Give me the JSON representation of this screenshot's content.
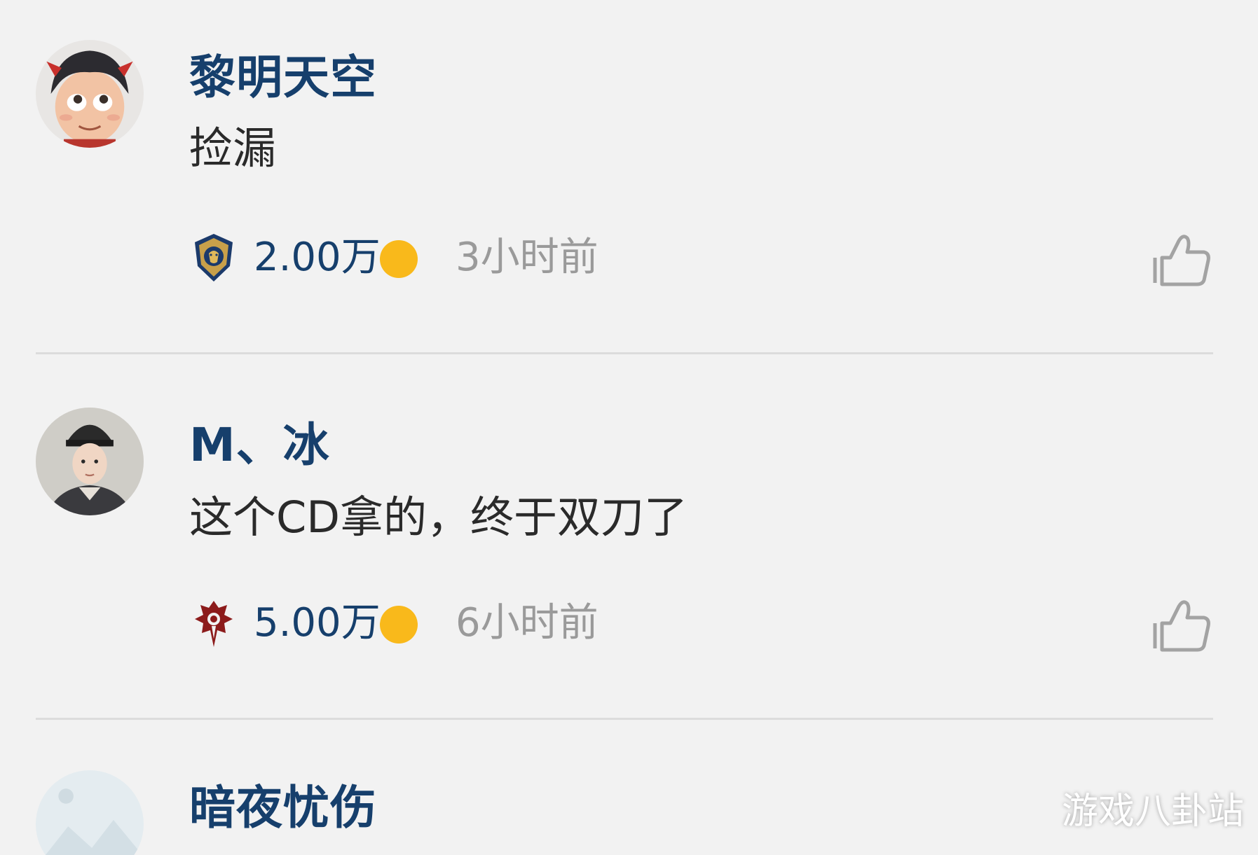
{
  "comments": [
    {
      "username": "黎明天空",
      "content": "捡漏",
      "faction": "alliance-icon",
      "coins": "2.00万",
      "time": "3小时前"
    },
    {
      "username": "M、冰",
      "content": "这个CD拿的，终于双刀了",
      "faction": "horde-icon",
      "coins": "5.00万",
      "time": "6小时前"
    },
    {
      "username": "暗夜忧伤"
    }
  ],
  "colors": {
    "username": "#163f6c",
    "coin": "#f9b91b",
    "time": "#9a9a9a",
    "background": "#f2f2f2"
  },
  "watermark": "游戏八卦站"
}
